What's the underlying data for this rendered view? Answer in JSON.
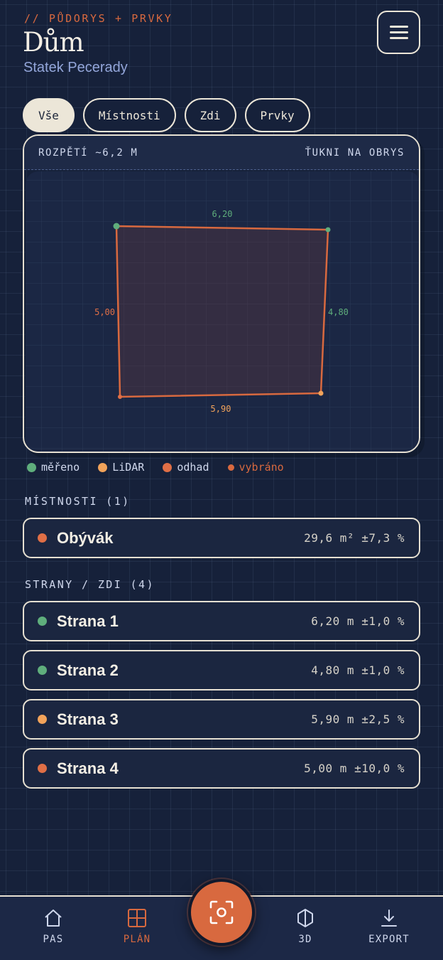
{
  "header": {
    "eyebrow": "// PŮDORYS + PRVKY",
    "title": "Dům",
    "subtitle": "Statek Pecerady"
  },
  "tabs": [
    {
      "label": "Vše",
      "active": true
    },
    {
      "label": "Místnosti",
      "active": false
    },
    {
      "label": "Zdi",
      "active": false
    },
    {
      "label": "Prvky",
      "active": false
    }
  ],
  "plan": {
    "span_label": "ROZPĚTÍ ~6,2 M",
    "hint_label": "ŤUKNI NA OBRYS",
    "edge_labels": {
      "top": "6,20",
      "right": "4,80",
      "bottom": "5,90",
      "left": "5,00"
    }
  },
  "legend": [
    {
      "label": "měřeno",
      "color": "#5fae7c"
    },
    {
      "label": "LiDAR",
      "color": "#f2a35a"
    },
    {
      "label": "odhad",
      "color": "#e06f46"
    },
    {
      "label": "vybráno",
      "color": "#d8693f"
    }
  ],
  "rooms": {
    "heading": "MÍSTNOSTI (1)",
    "items": [
      {
        "name": "Obývák",
        "value": "29,6 m² ±7,3 %",
        "color": "#e06f46"
      }
    ]
  },
  "walls": {
    "heading": "STRANY / ZDI (4)",
    "items": [
      {
        "name": "Strana 1",
        "value": "6,20 m ±1,0 %",
        "color": "#5fae7c"
      },
      {
        "name": "Strana 2",
        "value": "4,80 m ±1,0 %",
        "color": "#5fae7c"
      },
      {
        "name": "Strana 3",
        "value": "5,90 m ±2,5 %",
        "color": "#f2a35a"
      },
      {
        "name": "Strana 4",
        "value": "5,00 m ±10,0 %",
        "color": "#e06f46"
      }
    ]
  },
  "nav": {
    "pas": "PAS",
    "plan": "PLÁN",
    "view3d": "3D",
    "export": "EXPORT"
  },
  "colors": {
    "accent": "#d8693f",
    "measured": "#5fae7c",
    "lidar": "#f2a35a",
    "estimate": "#e06f46"
  }
}
